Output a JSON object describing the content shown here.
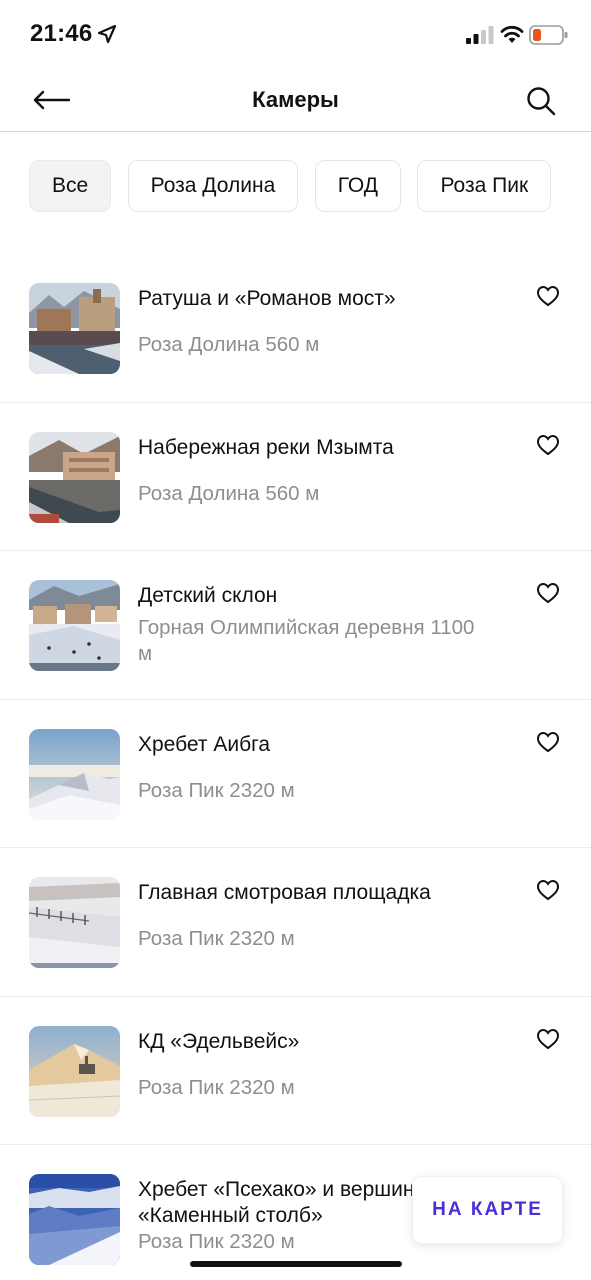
{
  "status": {
    "time": "21:46",
    "icons": [
      "location-arrow-icon",
      "signal-icon",
      "wifi-icon",
      "battery-icon"
    ],
    "battery_color": "#e9541f"
  },
  "header": {
    "title": "Камеры",
    "back_icon": "arrow-left-icon",
    "search_icon": "search-icon"
  },
  "filters": [
    {
      "label": "Все",
      "active": true
    },
    {
      "label": "Роза Долина",
      "active": false
    },
    {
      "label": "ГОД",
      "active": false
    },
    {
      "label": "Роза Пик",
      "active": false
    }
  ],
  "cameras": [
    {
      "title": "Ратуша и «Романов мост»",
      "subtitle": "Роза Долина 560 м"
    },
    {
      "title": "Набережная реки Мзымта",
      "subtitle": "Роза Долина 560 м"
    },
    {
      "title": "Детский склон",
      "subtitle": "Горная Олимпийская деревня 1100 м"
    },
    {
      "title": "Хребет Аибга",
      "subtitle": "Роза Пик 2320 м"
    },
    {
      "title": "Главная смотровая площадка",
      "subtitle": "Роза Пик 2320 м"
    },
    {
      "title": "КД «Эдельвейс»",
      "subtitle": "Роза Пик 2320 м"
    },
    {
      "title": "Хребет «Псехако» и вершина «Каменный столб»",
      "subtitle": "Роза Пик 2320 м"
    }
  ],
  "map_button": {
    "label": "НА КАРТЕ",
    "color": "#4a2fd8"
  },
  "accent": "#4a2fd8"
}
